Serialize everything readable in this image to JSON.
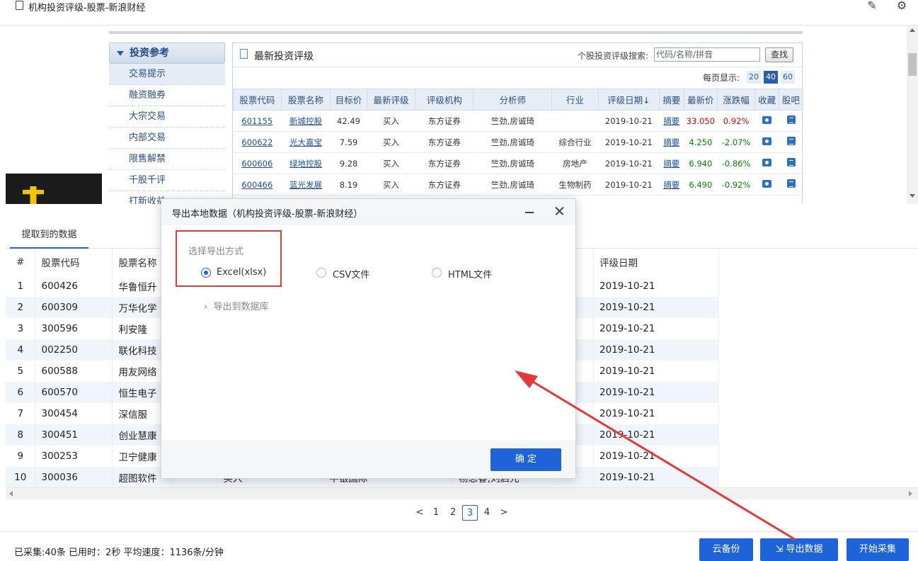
{
  "window": {
    "title": "机构投资评级-股票-新浪财经",
    "edit_icon": "edit-icon",
    "settings_icon": "gear-icon"
  },
  "webpage": {
    "sidebar": {
      "heading": "投资参考",
      "items": [
        "交易提示",
        "融资融券",
        "大宗交易",
        "内部交易",
        "限售解禁",
        "千股千评",
        "打新收益"
      ]
    },
    "panel": {
      "title": "最新投资评级",
      "search_label": "个股投资评级搜索:",
      "search_placeholder": "代码/名称/拼音",
      "search_button": "查找",
      "per_page_label": "每页显示:",
      "per_page_options": [
        "20",
        "40",
        "60"
      ],
      "per_page_selected": "40"
    },
    "ratings_table": {
      "headers": [
        "股票代码",
        "股票名称",
        "目标价",
        "最新评级",
        "评级机构",
        "分析师",
        "行业",
        "评级日期↓",
        "摘要",
        "最新价",
        "涨跌幅",
        "收藏",
        "股吧"
      ],
      "rows": [
        [
          "601155",
          "新城控股",
          "42.49",
          "买入",
          "东方证券",
          "竺劲,房诚琦",
          "",
          "2019-10-21",
          "摘要",
          "33.050",
          "0.92%"
        ],
        [
          "600622",
          "光大嘉宝",
          "7.59",
          "买入",
          "东方证券",
          "竺劲,房诚琦",
          "综合行业",
          "2019-10-21",
          "摘要",
          "4.250",
          "-2.07%"
        ],
        [
          "600606",
          "绿地控股",
          "9.28",
          "买入",
          "东方证券",
          "竺劲,房诚琦",
          "房地产",
          "2019-10-21",
          "摘要",
          "6.940",
          "-0.86%"
        ],
        [
          "600466",
          "蓝光发展",
          "8.19",
          "买入",
          "东方证券",
          "竺劲,房诚琦",
          "生物制药",
          "2019-10-21",
          "摘要",
          "6.490",
          "-0.92%"
        ]
      ],
      "change_direction": [
        "up",
        "down",
        "down",
        "down"
      ]
    }
  },
  "extract": {
    "tab_label": "提取到的数据",
    "headers": [
      "#",
      "股票代码",
      "股票名称",
      "评级日期"
    ],
    "rows": [
      [
        "1",
        "600426",
        "华鲁恒升",
        "2019-10-21"
      ],
      [
        "2",
        "600309",
        "万华化学",
        "2019-10-21"
      ],
      [
        "3",
        "300596",
        "利安隆",
        "2019-10-21"
      ],
      [
        "4",
        "002250",
        "联化科技",
        "2019-10-21"
      ],
      [
        "5",
        "600588",
        "用友网络",
        "2019-10-21"
      ],
      [
        "6",
        "600570",
        "恒生电子",
        "2019-10-21"
      ],
      [
        "7",
        "300454",
        "深信服",
        "2019-10-21"
      ],
      [
        "8",
        "300451",
        "创业慧康",
        "2019-10-21"
      ],
      [
        "9",
        "300253",
        "卫宁健康",
        "2019-10-21"
      ],
      [
        "10",
        "300036",
        "超图软件",
        "2019-10-21"
      ]
    ],
    "partial_row10": {
      "col4": "买入",
      "col5": "中银国际",
      "col6": "杨思睿,刘启元"
    },
    "pagination": {
      "prev": "<",
      "pages": [
        "1",
        "2",
        "3",
        "4"
      ],
      "current": "3",
      "next": ">"
    }
  },
  "status": {
    "stats": "已采集:40条 已用时：2秒 平均速度：1136条/分钟",
    "cloud_backup": "云备份",
    "export_data": "导出数据",
    "start_collect": "开始采集"
  },
  "modal": {
    "title": "导出本地数据（机构投资评级-股票-新浪财经）",
    "section_label": "选择导出方式",
    "options": [
      "Excel(xlsx)",
      "CSV文件",
      "HTML文件"
    ],
    "selected": "Excel(xlsx)",
    "export_db": "导出到数据库",
    "ok_button": "确 定"
  },
  "colors": {
    "accent": "#1f63d9",
    "annotation_red": "#e53935",
    "price_up": "#dd0000",
    "price_down": "#008800"
  }
}
